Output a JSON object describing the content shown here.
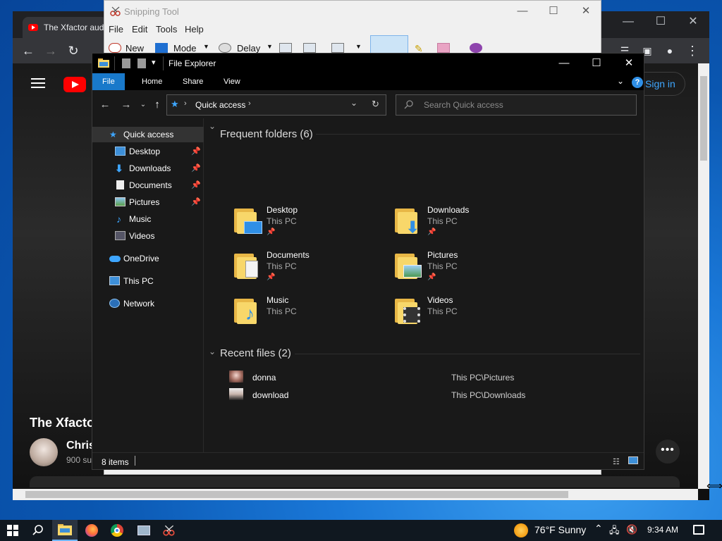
{
  "browser": {
    "tab_title": "The Xfactor aud",
    "window_controls": [
      "—",
      "☐",
      "✕"
    ],
    "video_title": "The Xfacto",
    "channel_name": "Chris",
    "channel_subs": "900 su",
    "sign_in": "Sign in",
    "sign_in_icon": "person-icon"
  },
  "snipping_tool": {
    "title": "Snipping Tool",
    "menu": [
      "File",
      "Edit",
      "Tools",
      "Help"
    ],
    "toolbar": {
      "new": "New",
      "mode": "Mode",
      "delay": "Delay"
    }
  },
  "file_explorer": {
    "title": "File Explorer",
    "ribbon_tabs": [
      "File",
      "Home",
      "Share",
      "View"
    ],
    "address_path": "Quick access",
    "search_placeholder": "Search Quick access",
    "nav_items": [
      {
        "label": "Quick access",
        "icon": "star-icon",
        "pinned": false,
        "selected": true
      },
      {
        "label": "Desktop",
        "icon": "desktop-icon",
        "pinned": true
      },
      {
        "label": "Downloads",
        "icon": "download-icon",
        "pinned": true
      },
      {
        "label": "Documents",
        "icon": "document-icon",
        "pinned": true
      },
      {
        "label": "Pictures",
        "icon": "picture-icon",
        "pinned": true
      },
      {
        "label": "Music",
        "icon": "music-icon",
        "pinned": false
      },
      {
        "label": "Videos",
        "icon": "video-icon",
        "pinned": false
      },
      {
        "label": "OneDrive",
        "icon": "cloud-icon",
        "pinned": false
      },
      {
        "label": "This PC",
        "icon": "computer-icon",
        "pinned": false
      },
      {
        "label": "Network",
        "icon": "network-icon",
        "pinned": false
      }
    ],
    "frequent_header": "Frequent folders (6)",
    "frequent_folders": [
      {
        "name": "Desktop",
        "location": "This PC",
        "pinned": true,
        "icon": "desktop-folder-icon"
      },
      {
        "name": "Downloads",
        "location": "This PC",
        "pinned": true,
        "icon": "downloads-folder-icon"
      },
      {
        "name": "Documents",
        "location": "This PC",
        "pinned": true,
        "icon": "documents-folder-icon"
      },
      {
        "name": "Pictures",
        "location": "This PC",
        "pinned": true,
        "icon": "pictures-folder-icon"
      },
      {
        "name": "Music",
        "location": "This PC",
        "pinned": false,
        "icon": "music-folder-icon"
      },
      {
        "name": "Videos",
        "location": "This PC",
        "pinned": false,
        "icon": "videos-folder-icon"
      }
    ],
    "recent_header": "Recent files (2)",
    "recent_files": [
      {
        "name": "donna",
        "path": "This PC\\Pictures"
      },
      {
        "name": "download",
        "path": "This PC\\Downloads"
      }
    ],
    "status_items": "8 items"
  },
  "taskbar": {
    "weather": "76°F  Sunny",
    "time": "9:34 AM",
    "accent": "#6fb6ff"
  }
}
